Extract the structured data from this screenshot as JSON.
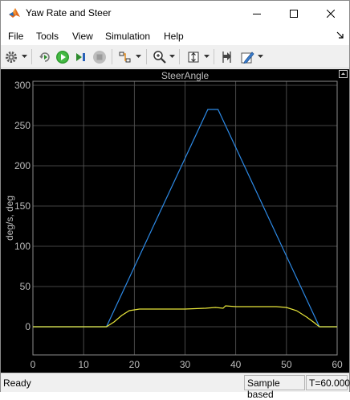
{
  "window": {
    "title": "Yaw Rate and Steer"
  },
  "menu": {
    "items": [
      "File",
      "Tools",
      "View",
      "Simulation",
      "Help"
    ]
  },
  "toolbar": {
    "buttons": [
      "settings-icon",
      "step-back-icon",
      "run-icon",
      "step-forward-icon",
      "stop-icon",
      "signal-highlight-icon",
      "zoom-icon",
      "autoscale-icon",
      "cursor-measurement-icon",
      "style-edit-icon"
    ]
  },
  "status": {
    "text": "Ready",
    "mode": "Sample based",
    "time": "T=60.000"
  },
  "colors": {
    "background": "#000000",
    "grid": "#5a5a5a",
    "axis_text": "#bdbdbd",
    "series1": "#2d8ae6",
    "series2": "#e8e63a"
  },
  "chart_data": {
    "type": "line",
    "title": "SteerAngle",
    "xlabel": "",
    "ylabel": "deg/s, deg",
    "xlim": [
      0,
      60
    ],
    "ylim": [
      -35,
      305
    ],
    "xticks": [
      0,
      10,
      20,
      30,
      40,
      50,
      60
    ],
    "yticks": [
      0,
      50,
      100,
      150,
      200,
      250,
      300
    ],
    "xtick_labels": [
      "0",
      "10",
      "20",
      "30",
      "40",
      "50",
      "60"
    ],
    "ytick_labels": [
      "0",
      "50",
      "100",
      "150",
      "200",
      "250",
      "300"
    ],
    "grid": true,
    "series": [
      {
        "color": "#2d8ae6",
        "x": [
          0,
          14.5,
          34.5,
          36.5,
          56.5,
          60
        ],
        "y": [
          0,
          0,
          270,
          270,
          0,
          0
        ]
      },
      {
        "color": "#e8e63a",
        "x": [
          0,
          14.5,
          16,
          17.5,
          19,
          21,
          25,
          30,
          34,
          36,
          37.5,
          38,
          40,
          45,
          48,
          50,
          52,
          54,
          55.5,
          56.5,
          60
        ],
        "y": [
          0,
          0,
          6,
          14,
          20,
          22,
          22,
          22,
          23,
          24,
          23,
          26,
          25,
          25,
          25,
          24,
          20,
          12,
          5,
          0,
          0
        ]
      }
    ]
  }
}
